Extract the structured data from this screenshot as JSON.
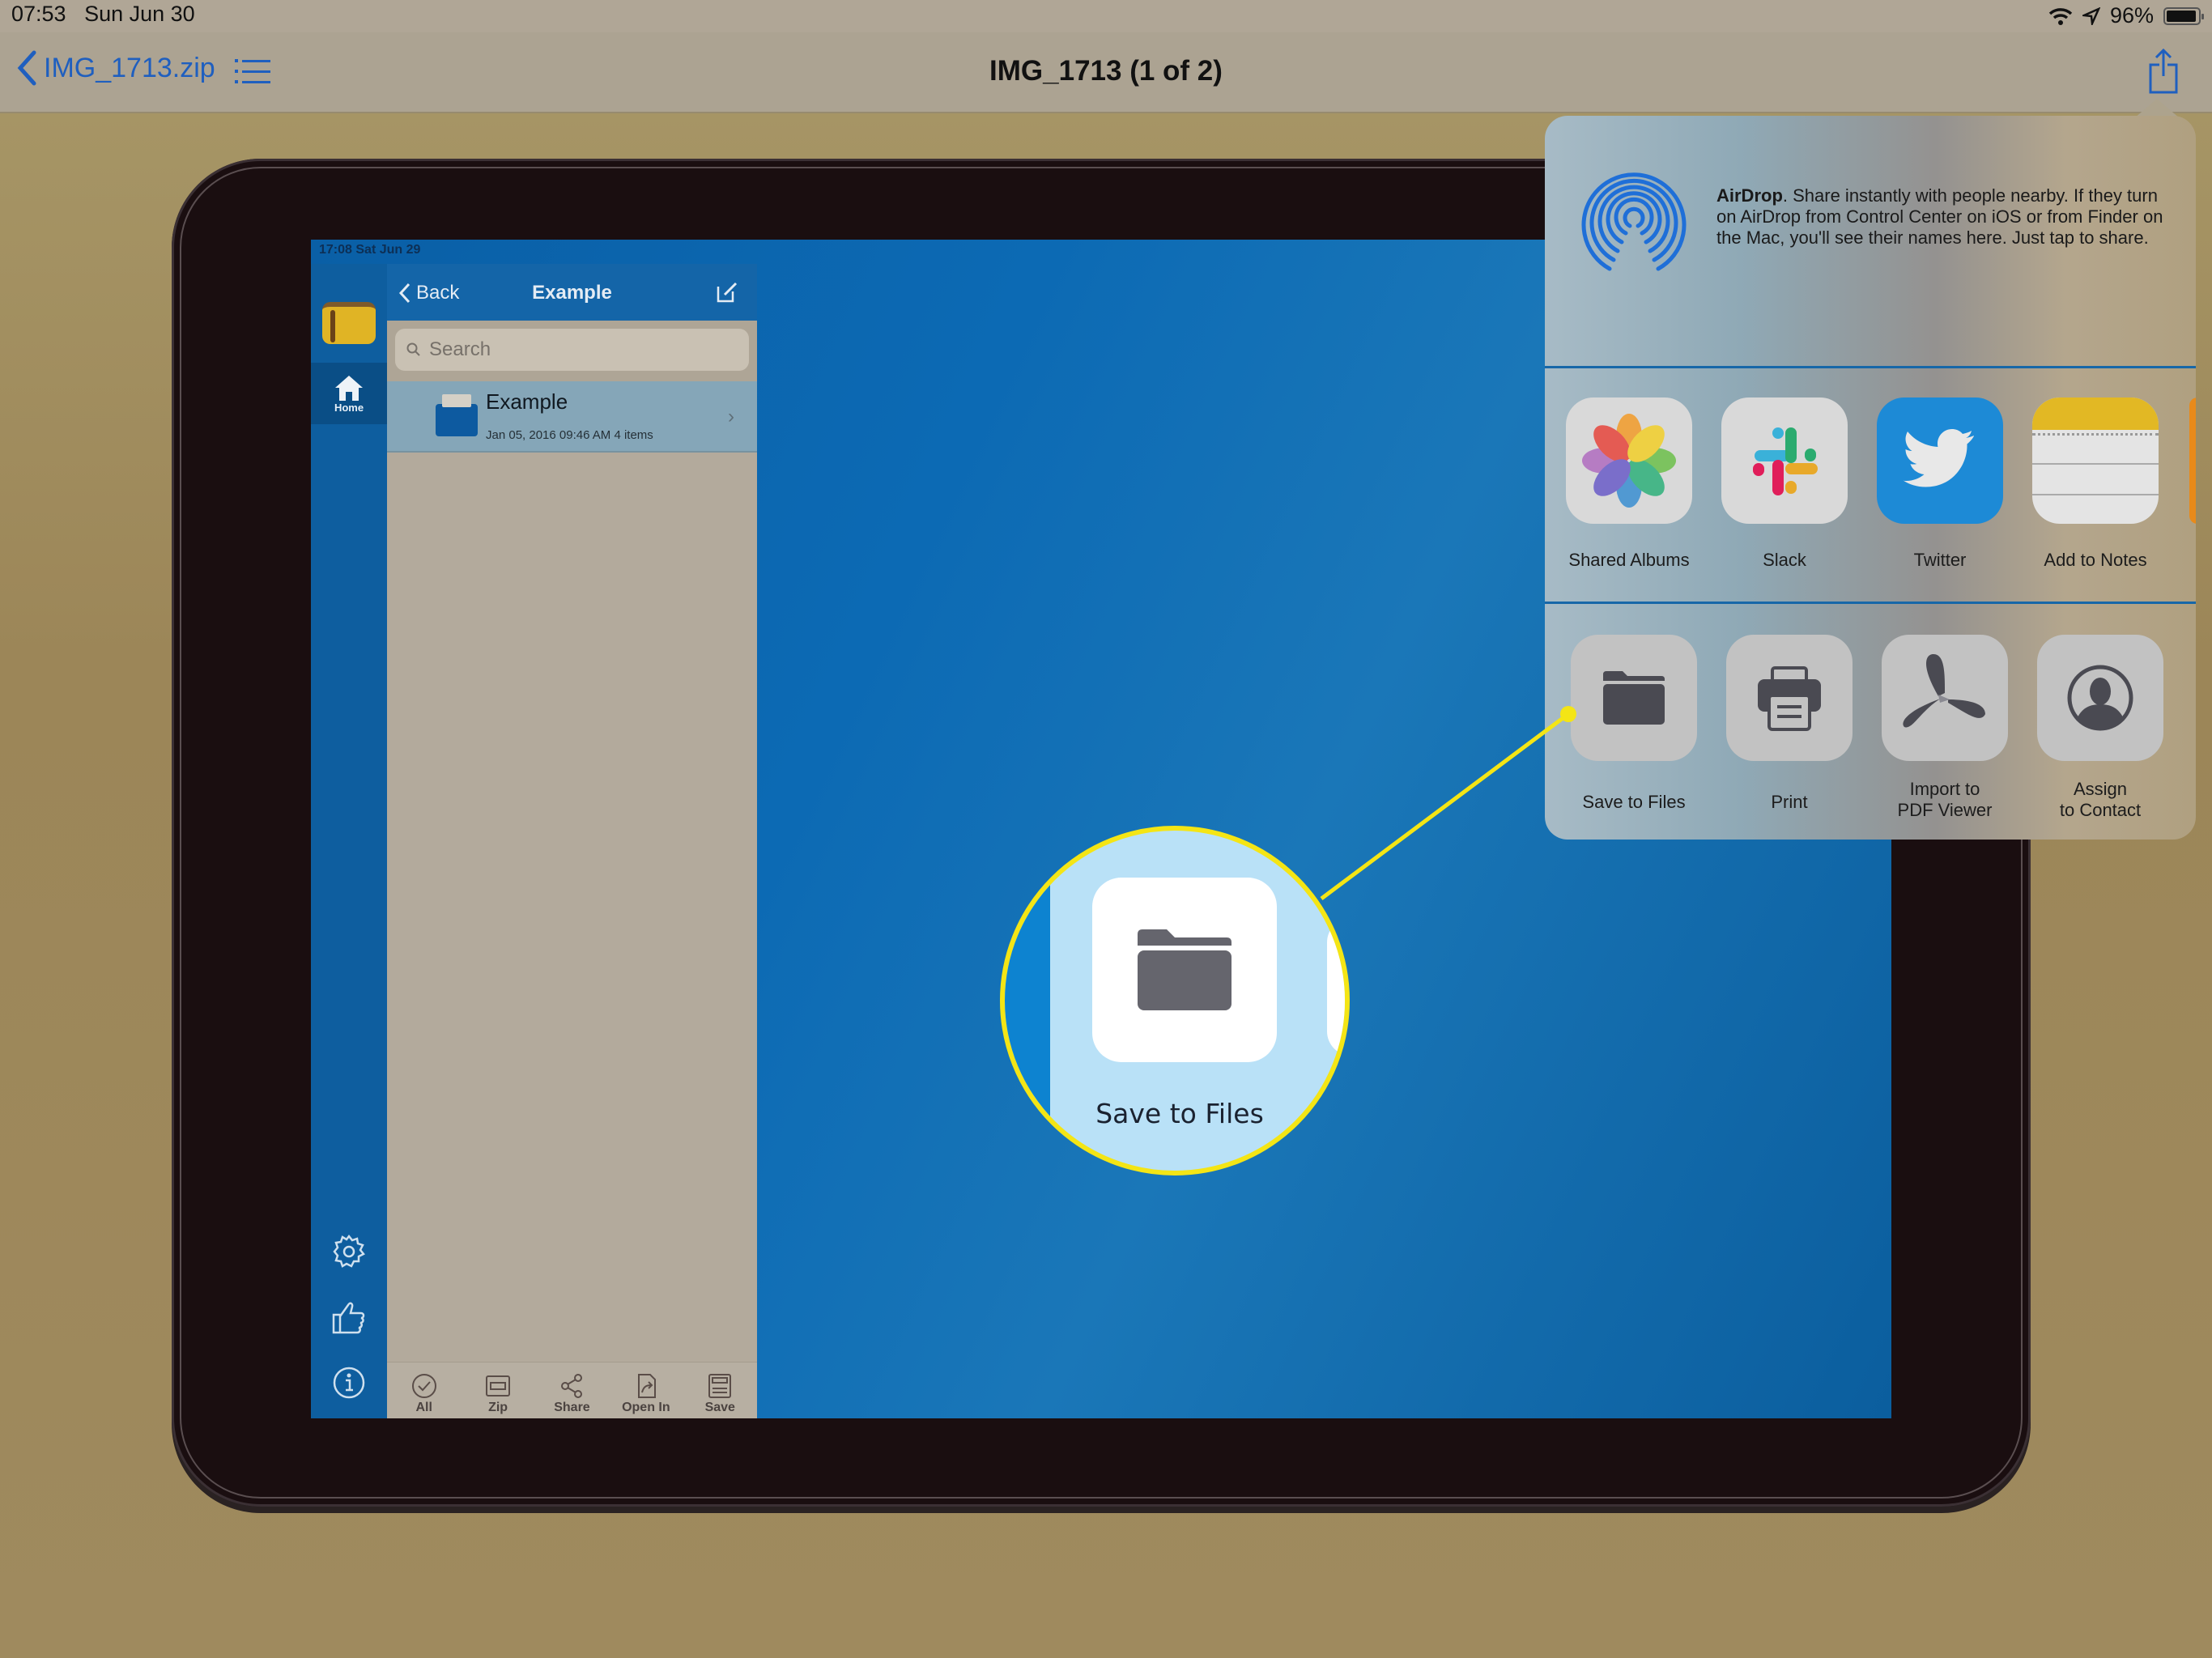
{
  "status_bar": {
    "time": "07:53",
    "date": "Sun Jun 30",
    "battery": "96%",
    "icons": [
      "wifi-icon",
      "location-icon",
      "battery-icon"
    ]
  },
  "nav_bar": {
    "back_label": "IMG_1713.zip",
    "title": "IMG_1713 (1 of 2)",
    "list_icon": "list-icon",
    "share_icon": "share-icon"
  },
  "inner_app": {
    "status": "17:08   Sat Jun 29",
    "sidebar": {
      "home_label": "Home",
      "icons": [
        "settings-icon",
        "thumbs-up-icon",
        "info-icon"
      ]
    },
    "header": {
      "back_label": "Back",
      "title": "Example"
    },
    "search": {
      "placeholder": "Search"
    },
    "rows": [
      {
        "name": "Example",
        "meta": "Jan 05, 2016 09:46 AM  4 items"
      }
    ],
    "toolbar": [
      {
        "label": "All"
      },
      {
        "label": "Zip"
      },
      {
        "label": "Share"
      },
      {
        "label": "Open In"
      },
      {
        "label": "Save"
      }
    ]
  },
  "share_sheet": {
    "airdrop": {
      "title": "AirDrop",
      "text": ". Share instantly with people nearby. If they turn on AirDrop from Control Center on iOS or from Finder on the Mac, you'll see their names here. Just tap to share."
    },
    "apps": [
      {
        "label": "Shared Albums"
      },
      {
        "label": "Slack"
      },
      {
        "label": "Twitter"
      },
      {
        "label": "Add to Notes"
      }
    ],
    "actions": [
      {
        "label": "Save to Files"
      },
      {
        "label": "Print"
      },
      {
        "label": "Import to\nPDF Viewer"
      },
      {
        "label": "Assign\nto Contact"
      }
    ]
  },
  "callout": {
    "label": "Save to Files",
    "color": "#f4e515"
  },
  "colors": {
    "accent": "#1f5fbf",
    "app_blue": "#1465a8",
    "twitter": "#1d8ad6",
    "notes_yellow": "#e2b824"
  }
}
